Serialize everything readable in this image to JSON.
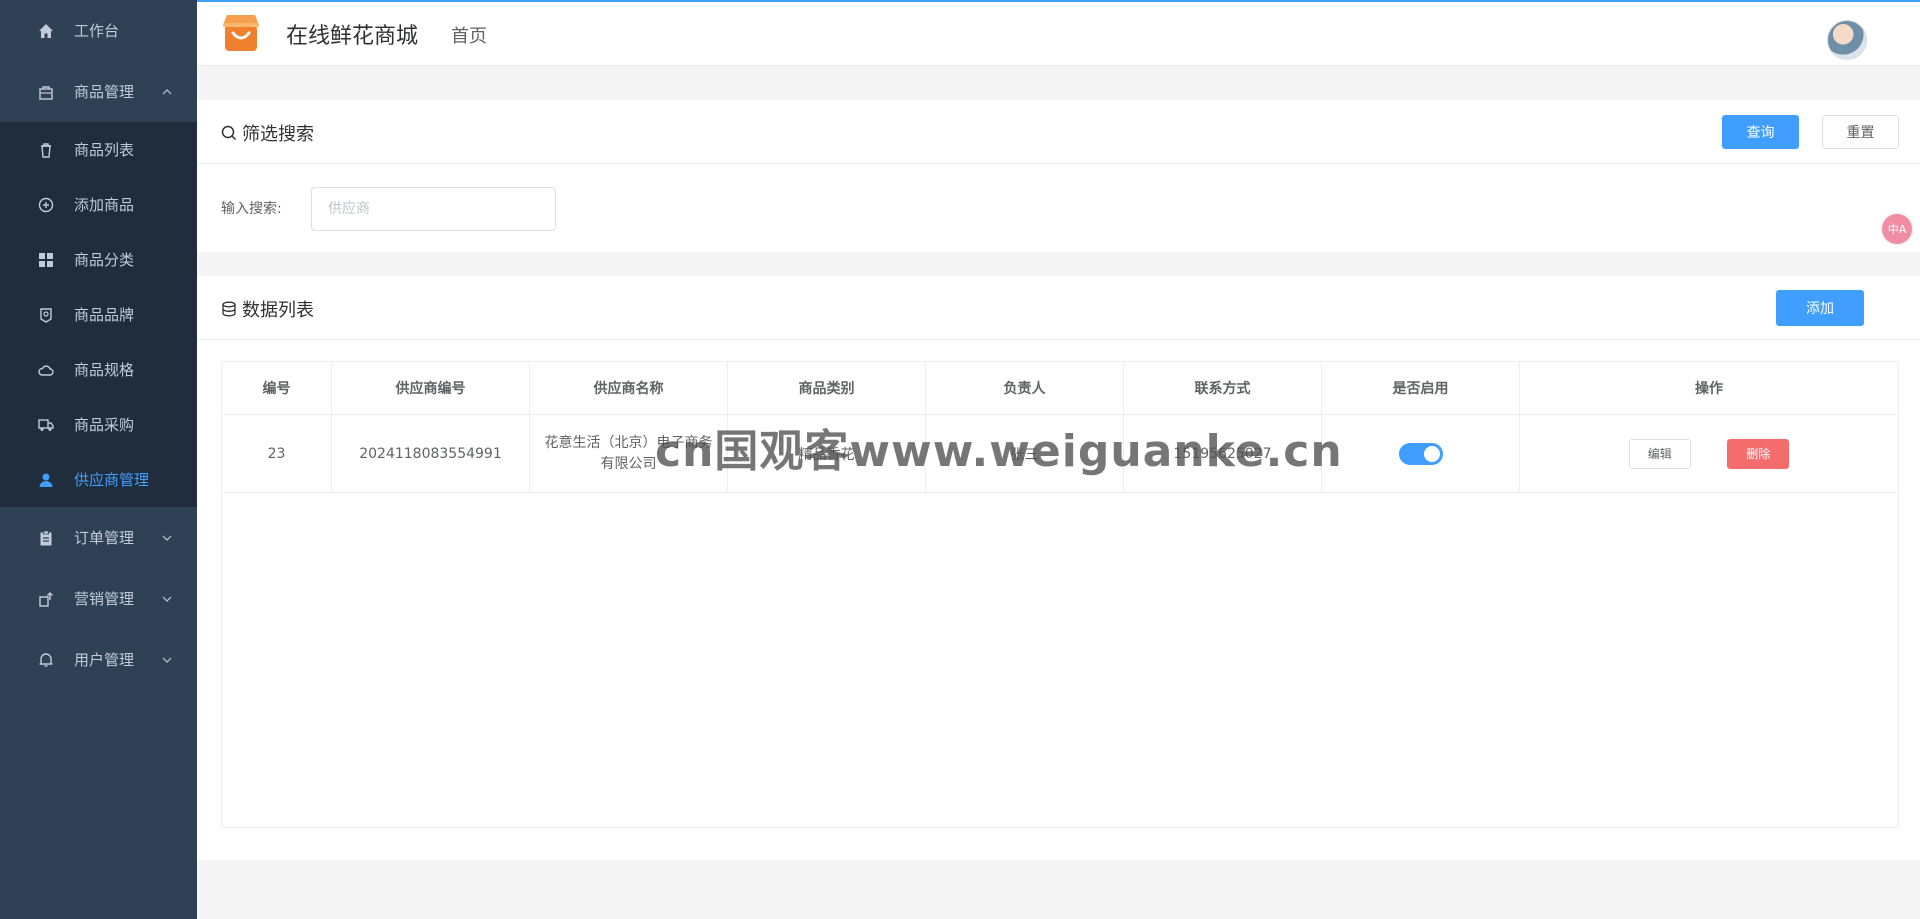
{
  "sidebar": {
    "items": [
      {
        "label": "工作台",
        "icon": "home-icon"
      },
      {
        "label": "商品管理",
        "icon": "bag-icon",
        "expanded": true
      },
      {
        "label": "订单管理",
        "icon": "clipboard-icon"
      },
      {
        "label": "营销管理",
        "icon": "marketing-icon"
      },
      {
        "label": "用户管理",
        "icon": "bell-icon"
      }
    ],
    "submenu": [
      {
        "label": "商品列表",
        "icon": "trash-bag-icon"
      },
      {
        "label": "添加商品",
        "icon": "plus-circle-icon"
      },
      {
        "label": "商品分类",
        "icon": "grid-icon"
      },
      {
        "label": "商品品牌",
        "icon": "badge-icon"
      },
      {
        "label": "商品规格",
        "icon": "cloud-icon"
      },
      {
        "label": "商品采购",
        "icon": "truck-icon"
      },
      {
        "label": "供应商管理",
        "icon": "user-icon",
        "active": true
      }
    ],
    "colors": {
      "bg": "#304156",
      "submenu_bg": "#1f2d3d",
      "active": "#409eff"
    }
  },
  "header": {
    "site_title": "在线鲜花商城",
    "home_link": "首页"
  },
  "filter": {
    "title": "筛选搜索",
    "query_button": "查询",
    "reset_button": "重置",
    "search_label": "输入搜索:",
    "search_placeholder": "供应商",
    "search_value": ""
  },
  "list": {
    "title": "数据列表",
    "add_button": "添加",
    "columns": [
      "编号",
      "供应商编号",
      "供应商名称",
      "商品类别",
      "负责人",
      "联系方式",
      "是否启用",
      "操作"
    ],
    "rows": [
      {
        "id": "23",
        "supplier_code": "2024118083554991",
        "supplier_name": "花意生活（北京）电子商务有限公司",
        "category": "精品香花",
        "manager": "张三",
        "contact": "15195625027",
        "enabled": true,
        "edit_label": "编辑",
        "delete_label": "删除"
      }
    ]
  },
  "watermark": "cn国观客www.weiguanke.cn",
  "translate_badge": "中A"
}
